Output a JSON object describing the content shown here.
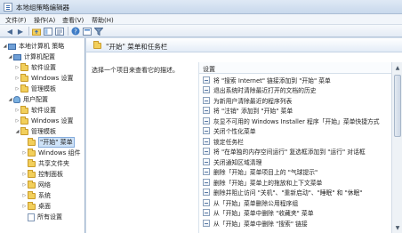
{
  "window": {
    "title": "本地组策略编辑器"
  },
  "menu": [
    {
      "label": "文件(F)"
    },
    {
      "label": "操作(A)"
    },
    {
      "label": "查看(V)"
    },
    {
      "label": "帮助(H)"
    }
  ],
  "toolbar": {
    "icons": [
      "back-arrow-icon",
      "forward-arrow-icon",
      "folder-up-icon",
      "show-hide-tree-icon",
      "export-list-icon",
      "help-icon",
      "properties-icon",
      "filter-icon"
    ]
  },
  "tree": [
    {
      "label": "本地计算机 策略",
      "icon": "pc",
      "expander": "◢"
    },
    {
      "label": "计算机配置",
      "icon": "pc",
      "expander": "◢"
    },
    {
      "label": "软件设置",
      "icon": "folder",
      "expander": "▷"
    },
    {
      "label": "Windows 设置",
      "icon": "folder",
      "expander": "▷"
    },
    {
      "label": "管理模板",
      "icon": "folder",
      "expander": "▷"
    },
    {
      "label": "用户配置",
      "icon": "user",
      "expander": "◢"
    },
    {
      "label": "软件设置",
      "icon": "folder",
      "expander": "▷"
    },
    {
      "label": "Windows 设置",
      "icon": "folder",
      "expander": "▷"
    },
    {
      "label": "管理模板",
      "icon": "folder",
      "expander": "◢"
    },
    {
      "label": "\"开始\" 菜单",
      "icon": "folder",
      "expander": "",
      "selected": true
    },
    {
      "label": "Windows 组件",
      "icon": "folder",
      "expander": "▷"
    },
    {
      "label": "共享文件夹",
      "icon": "folder",
      "expander": ""
    },
    {
      "label": "控制面板",
      "icon": "folder",
      "expander": "▷"
    },
    {
      "label": "网络",
      "icon": "folder",
      "expander": "▷"
    },
    {
      "label": "系统",
      "icon": "folder",
      "expander": "▷"
    },
    {
      "label": "桌面",
      "icon": "folder",
      "expander": "▷"
    },
    {
      "label": "所有设置",
      "icon": "doc",
      "expander": ""
    }
  ],
  "content": {
    "header_title": "\"开始\" 菜单和任务栏",
    "description": "选择一个项目来查看它的描述。",
    "column_header": "设置",
    "settings": [
      "将 \"搜索 Internet\" 链接添加到 \"开始\" 菜单",
      "退出系统时清除最近打开的文档的历史",
      "为新用户清除最近的程序列表",
      "将 \"注销\" 添加到 \"开始\" 菜单",
      "灰显不可用的 Windows Installer 程序「开始」菜单快捷方式",
      "关闭个性化菜单",
      "锁定任务栏",
      "将 \"在单独的内存空间运行\" 复选框添加到 \"运行\" 对话框",
      "关闭通知区域清理",
      "删除「开始」菜单项目上的 \"气球提示\"",
      "删除「开始」菜单上的拖放和上下文菜单",
      "删除并阻止访问 \"关机\"、\"重新启动\"、\"睡眠\" 和 \"休眠\"",
      "从「开始」菜单删除公用程序组",
      "从「开始」菜单中删除 \"收藏夹\" 菜单",
      "从「开始」菜单中删除 \"搜索\" 链接"
    ]
  },
  "scrollbar": {
    "up": "▲",
    "down": "▼"
  }
}
